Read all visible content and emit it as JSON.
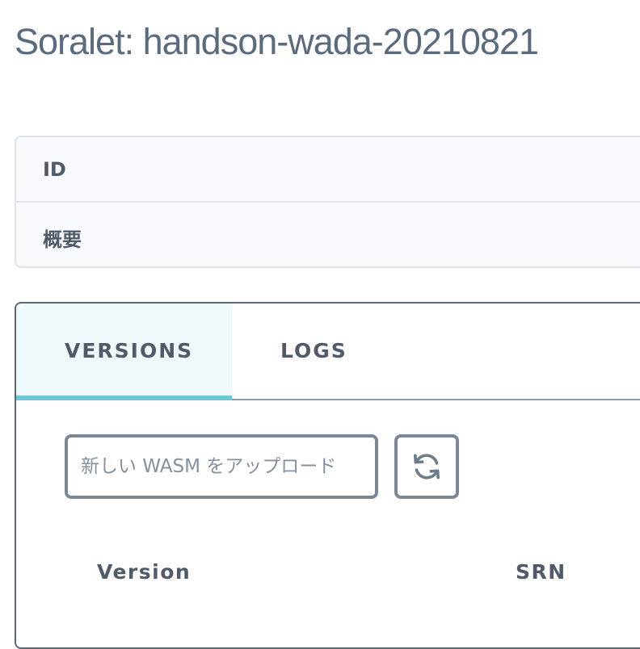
{
  "page": {
    "title": "Soralet: handson-wada-20210821"
  },
  "info": {
    "rows": [
      {
        "label": "ID"
      },
      {
        "label": "概要"
      }
    ]
  },
  "tabs": [
    {
      "label": "VERSIONS",
      "active": true
    },
    {
      "label": "LOGS",
      "active": false
    }
  ],
  "versions_panel": {
    "upload_placeholder": "新しい WASM をアップロード",
    "refresh_icon": "refresh-icon",
    "table": {
      "columns": [
        "Version",
        "SRN"
      ]
    }
  },
  "colors": {
    "accent": "#6cc7d2",
    "text": "#4f5b69",
    "border": "#7b8794"
  }
}
